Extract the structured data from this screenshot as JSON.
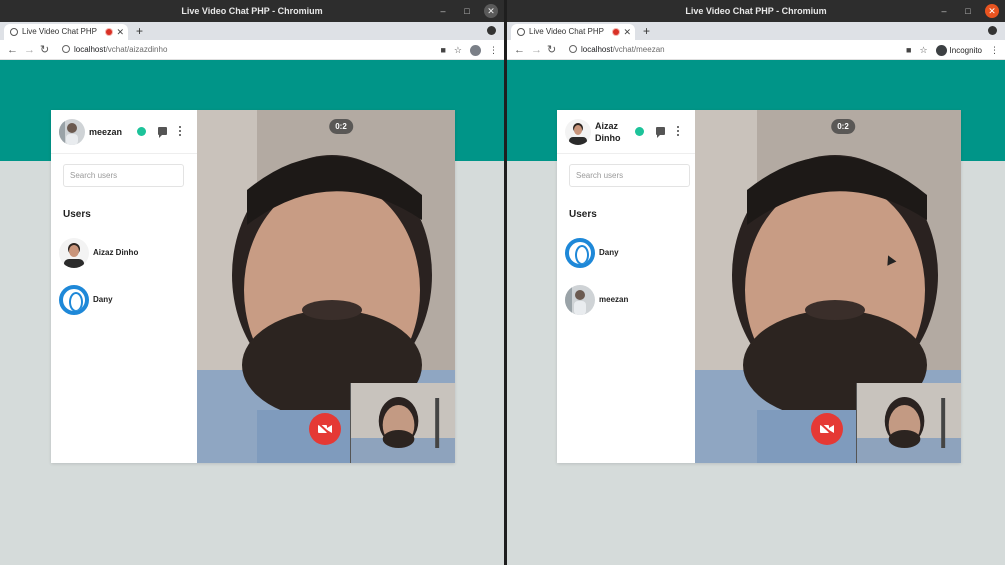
{
  "windows": [
    {
      "title": "Live Video Chat PHP - Chromium",
      "tab_title": "Live Video Chat PHP",
      "url_host": "localhost",
      "url_path": "/vchat/aizazdinho",
      "incognito": false,
      "me": {
        "name": "meezan"
      },
      "search_placeholder": "Search users",
      "users_heading": "Users",
      "users": [
        {
          "name": "Aizaz Dinho",
          "avatar": "photo"
        },
        {
          "name": "Dany",
          "avatar": "ring"
        }
      ],
      "call_timer": "0:2"
    },
    {
      "title": "Live Video Chat PHP - Chromium",
      "tab_title": "Live Video Chat PHP",
      "url_host": "localhost",
      "url_path": "/vchat/meezan",
      "incognito": true,
      "incognito_label": "Incognito",
      "me": {
        "name": "Aizaz Dinho"
      },
      "search_placeholder": "Search users",
      "users_heading": "Users",
      "users": [
        {
          "name": "Dany",
          "avatar": "ring"
        },
        {
          "name": "meezan",
          "avatar": "photo"
        }
      ],
      "call_timer": "0:2"
    }
  ],
  "colors": {
    "header_band": "#009588",
    "page_bg": "#d5dbda",
    "online": "#1dc39a",
    "hangup": "#e53935",
    "ring_avatar": "#1e88d8"
  },
  "icons": {
    "new_tab": "+",
    "tab_close": "✕",
    "back": "←",
    "forward": "→",
    "reload": "↻",
    "star": "☆",
    "camera": "■",
    "menu": "⋮",
    "minimize": "–",
    "maximize": "□",
    "close": "✕"
  }
}
